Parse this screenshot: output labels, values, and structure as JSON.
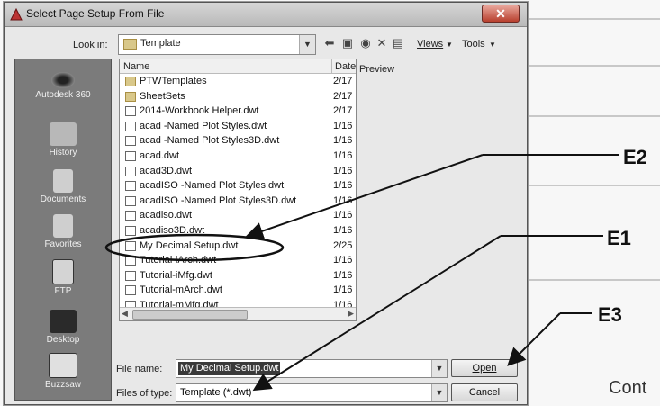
{
  "window": {
    "title": "Select Page Setup From File",
    "close_label": "✕"
  },
  "toolbar": {
    "look_in_label": "Look in:",
    "look_in_value": "Template",
    "views_label": "Views",
    "tools_label": "Tools"
  },
  "places": [
    {
      "label": "Autodesk 360",
      "icon": "cloud-icon"
    },
    {
      "label": "History",
      "icon": "history-icon"
    },
    {
      "label": "Documents",
      "icon": "documents-icon"
    },
    {
      "label": "Favorites",
      "icon": "favorites-icon"
    },
    {
      "label": "FTP",
      "icon": "ftp-icon"
    },
    {
      "label": "Desktop",
      "icon": "desktop-icon"
    },
    {
      "label": "Buzzsaw",
      "icon": "buzzsaw-icon"
    }
  ],
  "columns": {
    "name": "Name",
    "date": "Date"
  },
  "files": [
    {
      "name": "PTWTemplates",
      "date": "2/17",
      "type": "folder"
    },
    {
      "name": "SheetSets",
      "date": "2/17",
      "type": "folder"
    },
    {
      "name": "2014-Workbook Helper.dwt",
      "date": "2/17",
      "type": "dwt"
    },
    {
      "name": "acad -Named Plot Styles.dwt",
      "date": "1/16",
      "type": "dwt"
    },
    {
      "name": "acad -Named Plot Styles3D.dwt",
      "date": "1/16",
      "type": "dwt"
    },
    {
      "name": "acad.dwt",
      "date": "1/16",
      "type": "dwt"
    },
    {
      "name": "acad3D.dwt",
      "date": "1/16",
      "type": "dwt"
    },
    {
      "name": "acadISO -Named Plot Styles.dwt",
      "date": "1/16",
      "type": "dwt"
    },
    {
      "name": "acadISO -Named Plot Styles3D.dwt",
      "date": "1/16",
      "type": "dwt"
    },
    {
      "name": "acadiso.dwt",
      "date": "1/16",
      "type": "dwt"
    },
    {
      "name": "acadiso3D.dwt",
      "date": "1/16",
      "type": "dwt"
    },
    {
      "name": "My Decimal Setup.dwt",
      "date": "2/25",
      "type": "dwt"
    },
    {
      "name": "Tutorial-iArch.dwt",
      "date": "1/16",
      "type": "dwt"
    },
    {
      "name": "Tutorial-iMfg.dwt",
      "date": "1/16",
      "type": "dwt"
    },
    {
      "name": "Tutorial-mArch.dwt",
      "date": "1/16",
      "type": "dwt"
    },
    {
      "name": "Tutorial-mMfg.dwt",
      "date": "1/16",
      "type": "dwt"
    }
  ],
  "preview_label": "Preview",
  "file_name": {
    "label": "File name:",
    "value": "My Decimal Setup.dwt"
  },
  "file_type": {
    "label": "Files of type:",
    "value": "Template (*.dwt)"
  },
  "buttons": {
    "open": "Open",
    "cancel": "Cancel"
  },
  "callouts": {
    "e1": "E1",
    "e2": "E2",
    "e3": "E3"
  },
  "background_text": {
    "cont": "Cont"
  }
}
